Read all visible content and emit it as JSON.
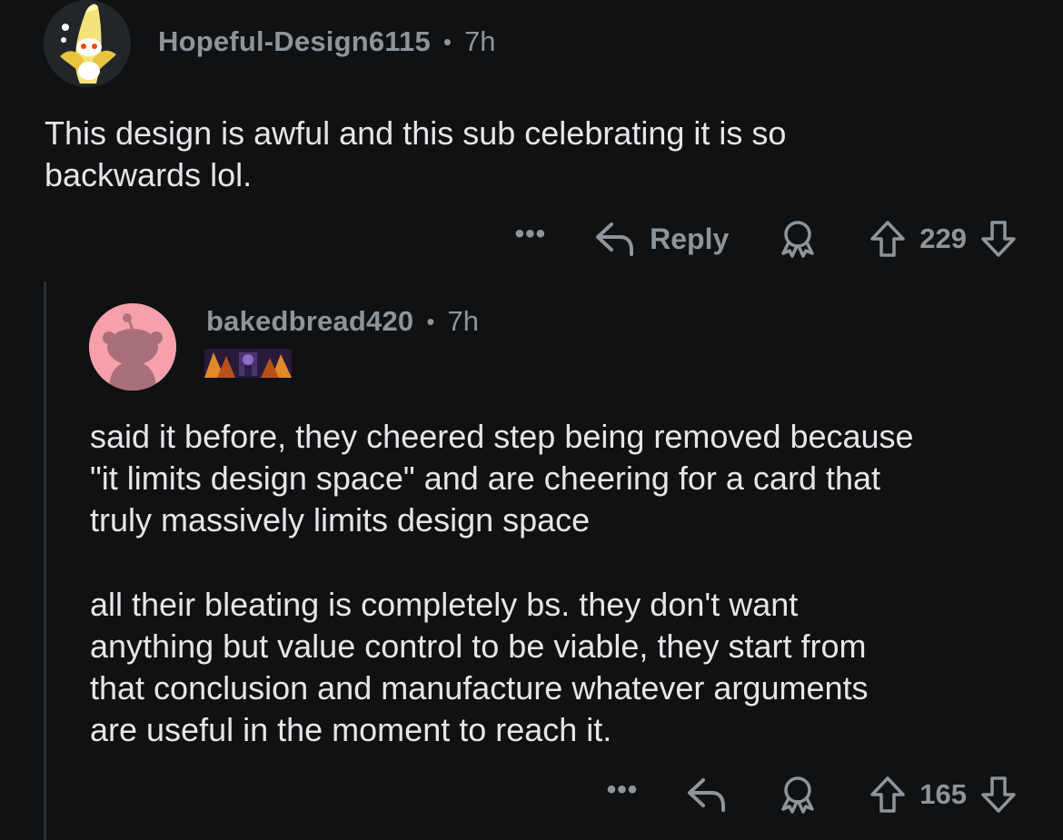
{
  "comments": [
    {
      "username": "Hopeful-Design6115",
      "separator": "•",
      "time": "7h",
      "body": "This design is awful and this sub celebrating it is so\nbackwards lol.",
      "more_label": "•••",
      "reply_label": "Reply",
      "score": "229"
    },
    {
      "username": "bakedbread420",
      "separator": "•",
      "time": "7h",
      "paragraphs": [
        "said it before, they cheered step being removed because\n\"it limits design space\" and are cheering for a card that\ntruly massively limits design space",
        "all their bleating is completely bs. they don't want\nanything but value control to be viable, they start from\nthat conclusion and manufacture whatever arguments\nare useful in the moment to reach it."
      ],
      "more_label": "•••",
      "score": "165"
    }
  ],
  "colors": {
    "background": "#0f1113",
    "text": "#e4e6e8",
    "muted": "#8d959b",
    "avatar_pink": "#f5a0aa"
  },
  "icons": [
    "banana-snoo-avatar",
    "snoo-avatar",
    "reply-arrow-icon",
    "award-icon",
    "upvote-icon",
    "downvote-icon",
    "more-icon"
  ]
}
